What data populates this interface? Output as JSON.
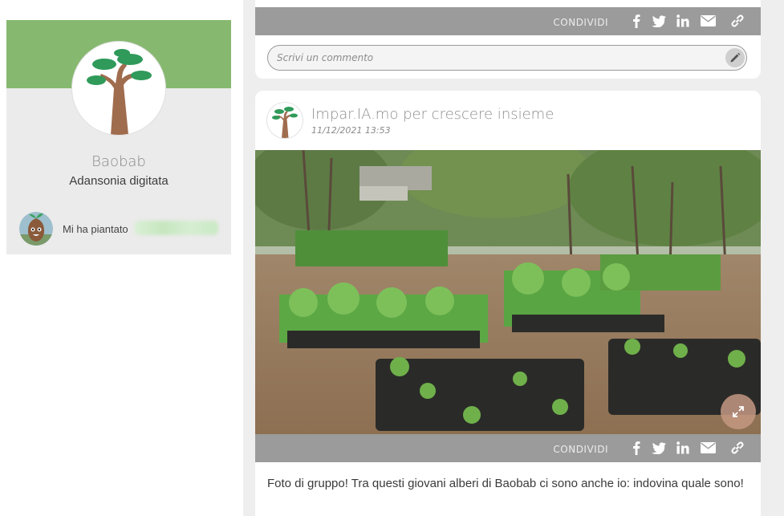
{
  "profile": {
    "name": "Baobab",
    "species": "Adansonia digitata",
    "planted_by_label": "Mi ha piantato",
    "colors": {
      "banner": "#86b96f",
      "card": "#ebebeb"
    }
  },
  "feed": {
    "top_card": {
      "share_label": "CONDIVIDI",
      "share_icons": [
        "facebook-icon",
        "twitter-icon",
        "linkedin-icon",
        "email-icon",
        "link-icon"
      ],
      "comment_placeholder": "Scrivi un commento"
    },
    "post": {
      "title": "Impar.IA.mo per crescere insieme",
      "date": "11/12/2021 13:53",
      "share_label": "CONDIVIDI",
      "text": "Foto di gruppo! Tra questi giovani alberi di Baobab ci sono anche io: indovina quale sono!"
    }
  }
}
